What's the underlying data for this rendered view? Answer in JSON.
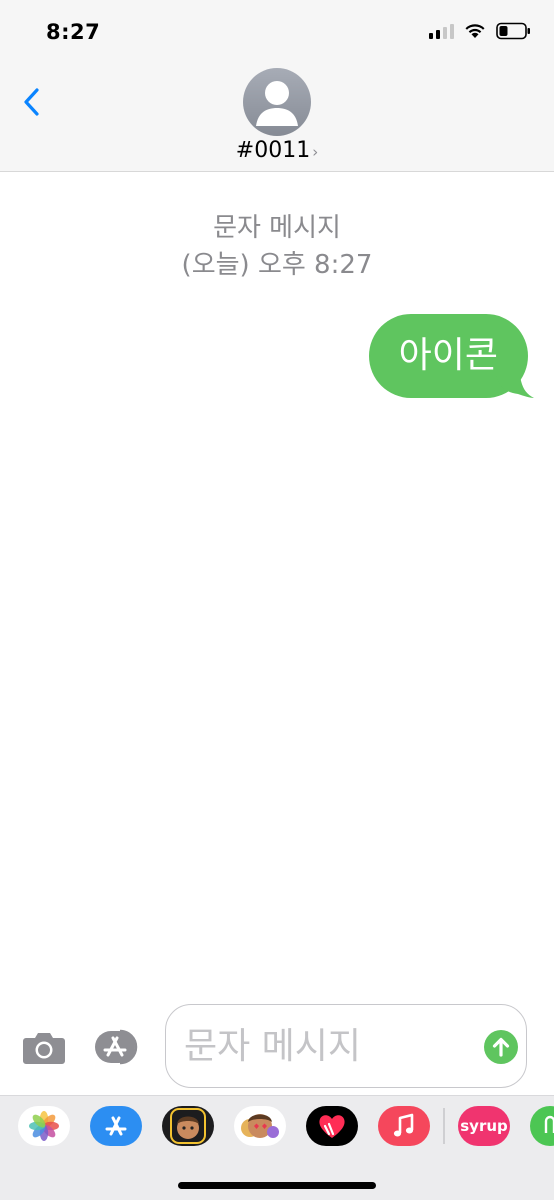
{
  "status_bar": {
    "time": "8:27"
  },
  "header": {
    "contact_name": "#0011",
    "chevron": "›"
  },
  "conversation": {
    "timestamp_line1": "문자 메시지",
    "timestamp_line2": "(오늘) 오후 8:27",
    "messages": [
      {
        "direction": "outgoing",
        "text": "아이콘"
      }
    ],
    "bubble_color": "#5fc55f"
  },
  "input": {
    "placeholder": "문자 메시지",
    "value": ""
  },
  "app_drawer": {
    "apps": [
      {
        "icon": "photos-icon"
      },
      {
        "icon": "app-store-icon"
      },
      {
        "icon": "memoji-icon"
      },
      {
        "icon": "memoji-stickers-icon"
      },
      {
        "icon": "digital-touch-icon"
      },
      {
        "icon": "music-icon"
      },
      {
        "icon": "syrup-icon",
        "label": "syrup"
      },
      {
        "icon": "more-app-icon"
      }
    ]
  },
  "colors": {
    "accent": "#0a84ff",
    "send": "#5fc55f",
    "header_bg": "#f6f6f6"
  }
}
